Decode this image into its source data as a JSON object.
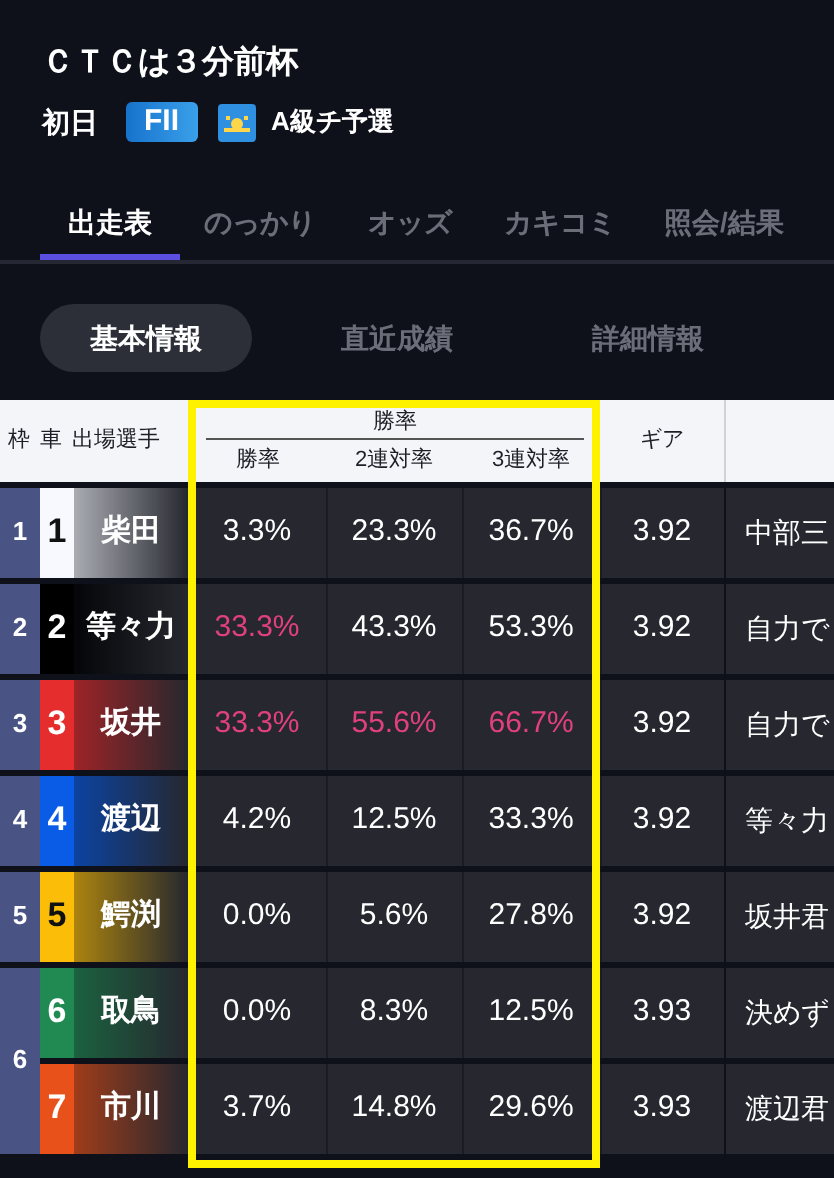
{
  "race": {
    "title": "ＣＴＣは３分前杯",
    "day": "初日",
    "grade_badge": "FII",
    "race_type": "A級チ予選"
  },
  "tabs": [
    {
      "label": "出走表",
      "selected": true
    },
    {
      "label": "のっかり",
      "selected": false
    },
    {
      "label": "オッズ",
      "selected": false
    },
    {
      "label": "カキコミ",
      "selected": false
    },
    {
      "label": "照会/結果",
      "selected": false
    }
  ],
  "segments": [
    {
      "label": "基本情報",
      "selected": true
    },
    {
      "label": "直近成績",
      "selected": false
    },
    {
      "label": "詳細情報",
      "selected": false
    }
  ],
  "table": {
    "highlight_frame": true,
    "header": {
      "frame": "枠",
      "car": "車",
      "rider": "出場選手",
      "group": "勝率",
      "stats": [
        "勝率",
        "2連対率",
        "3連対率"
      ],
      "gear": "ギア"
    },
    "frames": [
      {
        "number": "1",
        "cars": [
          {
            "car": "1",
            "color": "#f8f9ff",
            "rider": "柴田",
            "stats": [
              {
                "value": "3.3%",
                "highlighted": false
              },
              {
                "value": "23.3%",
                "highlighted": false
              },
              {
                "value": "36.7%",
                "highlighted": false
              }
            ],
            "gear": "3.92",
            "comment": "中部三"
          }
        ]
      },
      {
        "number": "2",
        "cars": [
          {
            "car": "2",
            "color": "#000000",
            "rider": "等々力",
            "stats": [
              {
                "value": "33.3%",
                "highlighted": true
              },
              {
                "value": "43.3%",
                "highlighted": false
              },
              {
                "value": "53.3%",
                "highlighted": false
              }
            ],
            "gear": "3.92",
            "comment": "自力で"
          }
        ]
      },
      {
        "number": "3",
        "cars": [
          {
            "car": "3",
            "color": "#e52d2d",
            "rider": "坂井",
            "stats": [
              {
                "value": "33.3%",
                "highlighted": true
              },
              {
                "value": "55.6%",
                "highlighted": true
              },
              {
                "value": "66.7%",
                "highlighted": true
              }
            ],
            "gear": "3.92",
            "comment": "自力で"
          }
        ]
      },
      {
        "number": "4",
        "cars": [
          {
            "car": "4",
            "color": "#0a5ce6",
            "rider": "渡辺",
            "stats": [
              {
                "value": "4.2%",
                "highlighted": false
              },
              {
                "value": "12.5%",
                "highlighted": false
              },
              {
                "value": "33.3%",
                "highlighted": false
              }
            ],
            "gear": "3.92",
            "comment": "等々力"
          }
        ]
      },
      {
        "number": "5",
        "cars": [
          {
            "car": "5",
            "color": "#fbbd08",
            "rider": "鰐渕",
            "stats": [
              {
                "value": "0.0%",
                "highlighted": false
              },
              {
                "value": "5.6%",
                "highlighted": false
              },
              {
                "value": "27.8%",
                "highlighted": false
              }
            ],
            "gear": "3.92",
            "comment": "坂井君"
          }
        ]
      },
      {
        "number": "6",
        "cars": [
          {
            "car": "6",
            "color": "#218a52",
            "rider": "取鳥",
            "stats": [
              {
                "value": "0.0%",
                "highlighted": false
              },
              {
                "value": "8.3%",
                "highlighted": false
              },
              {
                "value": "12.5%",
                "highlighted": false
              }
            ],
            "gear": "3.93",
            "comment": "決めず"
          },
          {
            "car": "7",
            "color": "#e8521a",
            "rider": "市川",
            "stats": [
              {
                "value": "3.7%",
                "highlighted": false
              },
              {
                "value": "14.8%",
                "highlighted": false
              },
              {
                "value": "29.6%",
                "highlighted": false
              }
            ],
            "gear": "3.93",
            "comment": "渡辺君"
          }
        ]
      }
    ]
  }
}
